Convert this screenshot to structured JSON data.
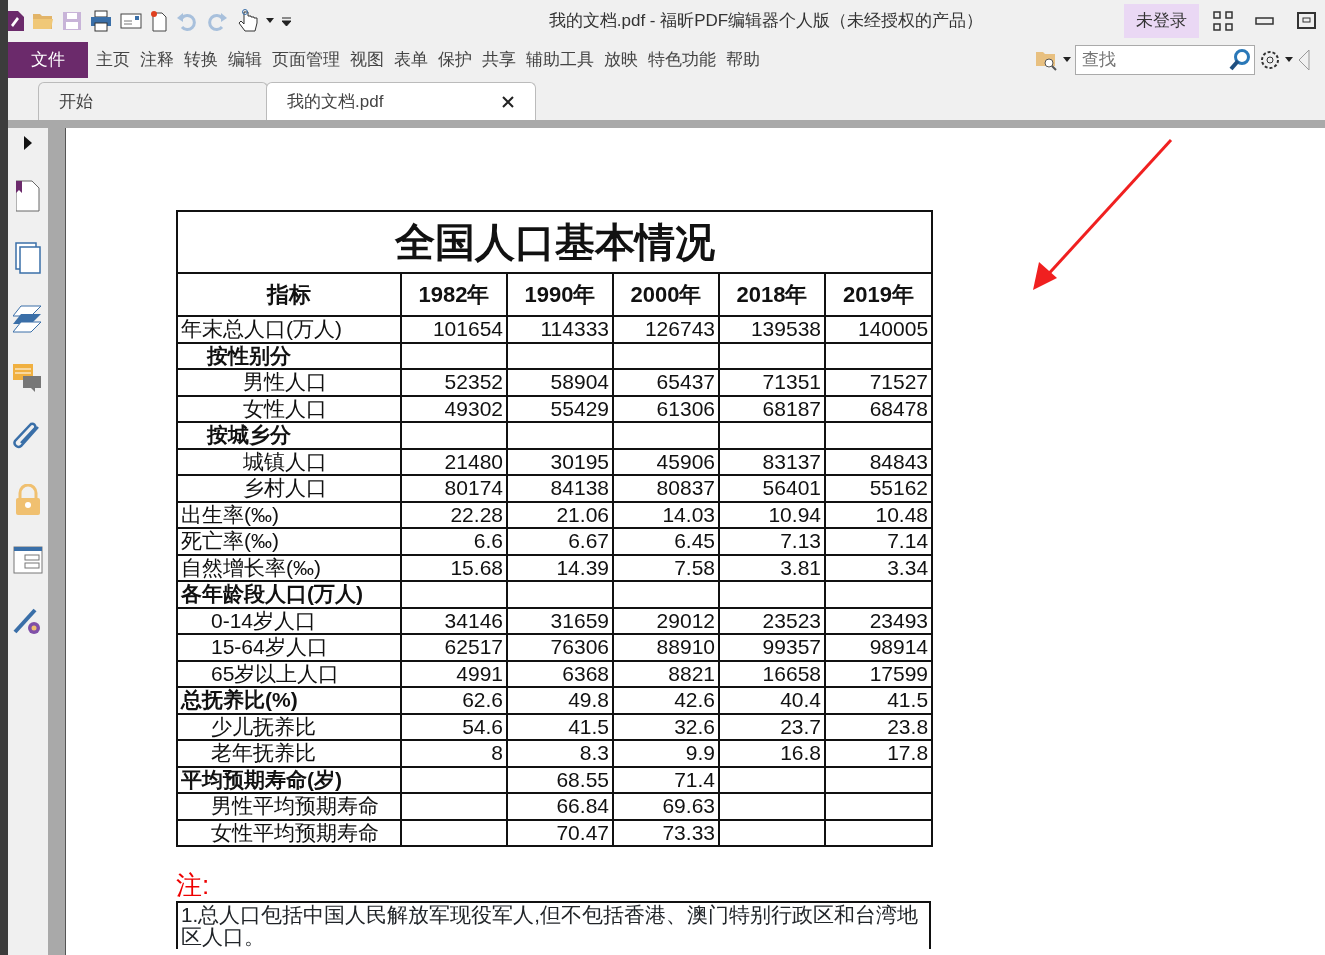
{
  "window": {
    "title": "我的文档.pdf - 福昕PDF编辑器个人版（未经授权的产品）"
  },
  "account_button": "未登录",
  "menu": [
    {
      "label": "文件",
      "selected": true
    },
    {
      "label": "主页",
      "selected": false
    },
    {
      "label": "注释",
      "selected": false
    },
    {
      "label": "转换",
      "selected": false
    },
    {
      "label": "编辑",
      "selected": false
    },
    {
      "label": "页面管理",
      "selected": false
    },
    {
      "label": "视图",
      "selected": false
    },
    {
      "label": "表单",
      "selected": false
    },
    {
      "label": "保护",
      "selected": false
    },
    {
      "label": "共享",
      "selected": false
    },
    {
      "label": "辅助工具",
      "selected": false
    },
    {
      "label": "放映",
      "selected": false
    },
    {
      "label": "特色功能",
      "selected": false
    },
    {
      "label": "帮助",
      "selected": false
    }
  ],
  "search": {
    "placeholder": "查找"
  },
  "tabs": [
    {
      "label": "开始",
      "selected": false,
      "closable": false
    },
    {
      "label": "我的文档.pdf",
      "selected": true,
      "closable": true
    }
  ],
  "document": {
    "table": {
      "title": "全国人口基本情况",
      "columns": [
        "指标",
        "1982年",
        "1990年",
        "2000年",
        "2018年",
        "2019年"
      ],
      "rows": [
        {
          "label": "年末总人口(万人)",
          "bold": false,
          "values": {
            "column_2": "101654",
            "column_3": "114333",
            "column_4": "126743",
            "column_5": "139538",
            "column_6": "140005"
          },
          "children": [
            {
              "label": "按性别分",
              "bold": true,
              "children": [
                {
                  "label": "男性人口",
                  "bold": false,
                  "values": {
                    "column_2": "52352",
                    "column_3": "58904",
                    "column_4": "65437",
                    "column_5": "71351",
                    "column_6": "71527"
                  }
                },
                {
                  "label": "女性人口",
                  "bold": false,
                  "values": {
                    "column_2": "49302",
                    "column_3": "55429",
                    "column_4": "61306",
                    "column_5": "68187",
                    "column_6": "68478"
                  }
                }
              ]
            },
            {
              "label": "按城乡分",
              "bold": true,
              "children": [
                {
                  "label": "城镇人口",
                  "bold": false,
                  "values": {
                    "column_2": "21480",
                    "column_3": "30195",
                    "column_4": "45906",
                    "column_5": "83137",
                    "column_6": "84843"
                  }
                },
                {
                  "label": "乡村人口",
                  "bold": false,
                  "values": {
                    "column_2": "80174",
                    "column_3": "84138",
                    "column_4": "80837",
                    "column_5": "56401",
                    "column_6": "55162"
                  }
                }
              ]
            }
          ]
        },
        {
          "label": "出生率(‰)",
          "bold": false,
          "values": {
            "column_2": "22.28",
            "column_3": "21.06",
            "column_4": "14.03",
            "column_5": "10.94",
            "column_6": "10.48"
          }
        },
        {
          "label": "死亡率(‰)",
          "bold": false,
          "values": {
            "column_2": "6.6",
            "column_3": "6.67",
            "column_4": "6.45",
            "column_5": "7.13",
            "column_6": "7.14"
          }
        },
        {
          "label": "自然增长率(‰)",
          "bold": false,
          "values": {
            "column_2": "15.68",
            "column_3": "14.39",
            "column_4": "7.58",
            "column_5": "3.81",
            "column_6": "3.34"
          }
        },
        {
          "label": "各年龄段人口(万人)",
          "bold": true,
          "children": [
            {
              "label": "0-14岁人口",
              "bold": false,
              "values": {
                "column_2": "34146",
                "column_3": "31659",
                "column_4": "29012",
                "column_5": "23523",
                "column_6": "23493"
              }
            },
            {
              "label": "15-64岁人口",
              "bold": false,
              "values": {
                "column_2": "62517",
                "column_3": "76306",
                "column_4": "88910",
                "column_5": "99357",
                "column_6": "98914"
              }
            },
            {
              "label": "65岁以上人口",
              "bold": false,
              "values": {
                "column_2": "4991",
                "column_3": "6368",
                "column_4": "8821",
                "column_5": "16658",
                "column_6": "17599"
              }
            }
          ]
        },
        {
          "label": "总抚养比(%)",
          "bold": true,
          "values": {
            "column_2": "62.6",
            "column_3": "49.8",
            "column_4": "42.6",
            "column_5": "40.4",
            "column_6": "41.5"
          },
          "children": [
            {
              "label": "少儿抚养比",
              "bold": false,
              "values": {
                "column_2": "54.6",
                "column_3": "41.5",
                "column_4": "32.6",
                "column_5": "23.7",
                "column_6": "23.8"
              }
            },
            {
              "label": "老年抚养比",
              "bold": false,
              "values": {
                "column_2": "8",
                "column_3": "8.3",
                "column_4": "9.9",
                "column_5": "16.8",
                "column_6": "17.8"
              }
            }
          ]
        },
        {
          "label": "平均预期寿命(岁)",
          "bold": true,
          "values": {
            "column_3": "68.55",
            "column_4": "71.4"
          },
          "children": [
            {
              "label": "男性平均预期寿命",
              "bold": false,
              "values": {
                "column_3": "66.84",
                "column_4": "69.63"
              }
            },
            {
              "label": "女性平均预期寿命",
              "bold": false,
              "values": {
                "column_3": "70.47",
                "column_4": "73.33"
              }
            }
          ]
        }
      ]
    },
    "note": {
      "label": "注:",
      "text": "1.总人口包括中国人民解放军现役军人,但不包括香港、澳门特别行政区和台湾地区人口。"
    }
  }
}
